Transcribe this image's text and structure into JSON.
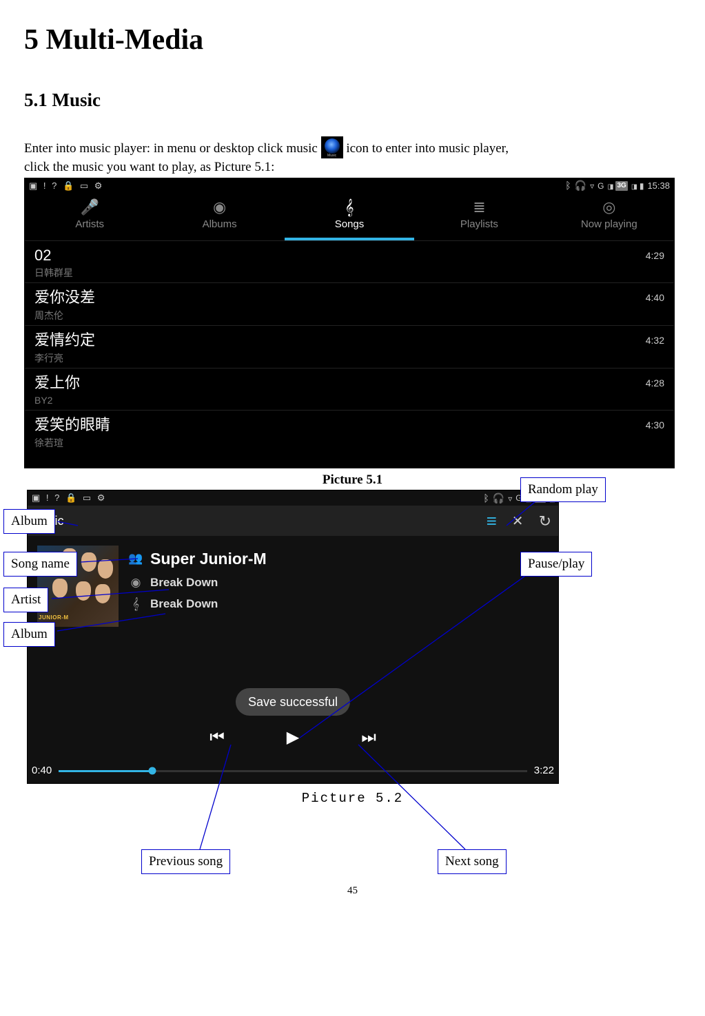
{
  "headings": {
    "chapter": "5 Multi-Media",
    "section": "5.1 Music"
  },
  "intro": {
    "line1_a": "Enter into music player: in menu or desktop click music ",
    "line1_b": " icon to enter into music player,",
    "line2": "click the music you want to play, as Picture 5.1:"
  },
  "captions": {
    "pic51": "Picture 5.1",
    "pic52": "Picture 5.2"
  },
  "status": {
    "time": "15:38",
    "sig": "3G"
  },
  "tabs": {
    "artists": "Artists",
    "albums": "Albums",
    "songs": "Songs",
    "playlists": "Playlists",
    "nowplaying": "Now playing"
  },
  "songs": [
    {
      "title": "02",
      "artist": "日韩群星",
      "duration": "4:29"
    },
    {
      "title": "爱你没差",
      "artist": "周杰伦",
      "duration": "4:40"
    },
    {
      "title": "爱情约定",
      "artist": "李行亮",
      "duration": "4:32"
    },
    {
      "title": "爱上你",
      "artist": "BY2",
      "duration": "4:28"
    },
    {
      "title": "爱笑的眼睛",
      "artist": "徐若瑄",
      "duration": "4:30"
    }
  ],
  "player": {
    "header": "sic",
    "group": "Super Junior-M",
    "track": "Break Down",
    "album": "Break Down",
    "album_band_label": "JUNIOR-M",
    "toast": "Save successful",
    "elapsed": "0:40",
    "total": "3:22"
  },
  "callouts": {
    "album_top": "Album",
    "songname": "Song name",
    "artist": "Artist",
    "album_bottom": "Album",
    "random": "Random play",
    "pauseplay": "Pause/play",
    "previous": "Previous song",
    "next": "Next song"
  },
  "page_number": "45"
}
